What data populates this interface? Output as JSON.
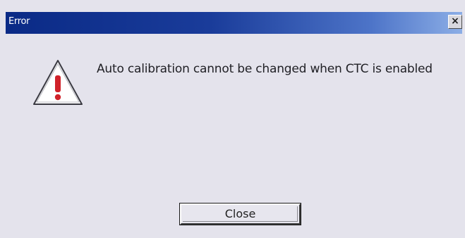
{
  "window": {
    "title": "Error",
    "close_glyph": "×"
  },
  "message": {
    "text": "Auto calibration cannot be changed when CTC is enabled",
    "icon": "warning-icon"
  },
  "buttons": {
    "close_label": "Close"
  },
  "colors": {
    "titlebar_start": "#0a2a86",
    "titlebar_end": "#8caee6",
    "dialog_background": "#e4e3ec",
    "warning_fill": "#ffffff",
    "warning_mark": "#d0222a"
  }
}
